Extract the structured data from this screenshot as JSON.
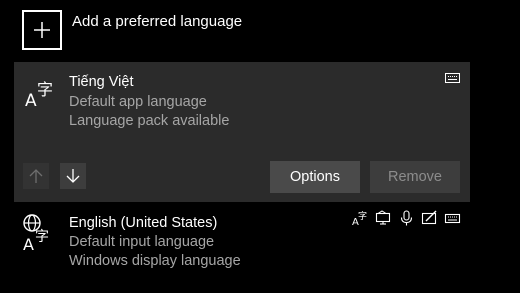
{
  "add_language": {
    "label": "Add a preferred language",
    "icon": "plus-icon"
  },
  "selected_language": {
    "name": "Tiếng Việt",
    "line1": "Default app language",
    "line2": "Language pack available",
    "icon": "language-icon",
    "feature_icons": [
      "keyboard-icon"
    ],
    "move_up_icon": "arrow-up-icon",
    "move_down_icon": "arrow-down-icon",
    "move_up_enabled": false,
    "move_down_enabled": true,
    "options_label": "Options",
    "remove_label": "Remove",
    "remove_enabled": false
  },
  "second_language": {
    "name": "English (United States)",
    "line1": "Default input language",
    "line2": "Windows display language",
    "icon": "globe-language-icon",
    "feature_icons": [
      "language-pack-icon",
      "display-icon",
      "microphone-icon",
      "handwriting-icon",
      "keyboard-icon"
    ]
  },
  "colors": {
    "background": "#000000",
    "panel": "#2b2b2b",
    "button": "#4a4a4a",
    "button_disabled": "#3d3d3d",
    "secondary_text": "#a6a6a6"
  }
}
